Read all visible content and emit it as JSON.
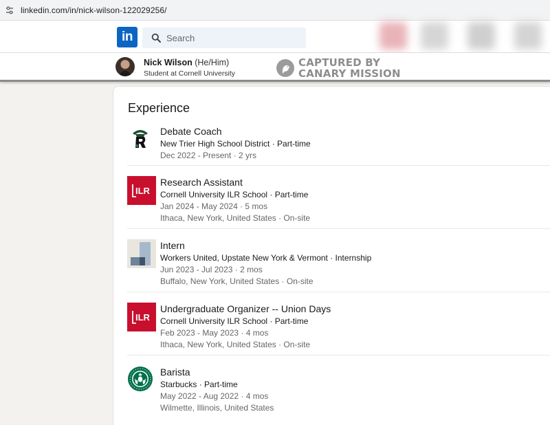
{
  "browser": {
    "url": "linkedin.com/in/nick-wilson-122029256/"
  },
  "nav": {
    "logo_text": "in",
    "search_placeholder": "Search"
  },
  "profile": {
    "name": "Nick Wilson",
    "pronouns": "(He/Him)",
    "headline": "Student at Cornell University"
  },
  "watermark": {
    "line1": "CAPTURED BY",
    "line2": "CANARY MISSION"
  },
  "experience": {
    "heading": "Experience",
    "items": [
      {
        "title": "Debate Coach",
        "company": "New Trier High School District · Part-time",
        "dates": "Dec 2022 - Present · 2 yrs",
        "location": "",
        "logo": "new-trier-trevian-logo"
      },
      {
        "title": "Research Assistant",
        "company": "Cornell University ILR School · Part-time",
        "dates": "Jan 2024 - May 2024 · 5 mos",
        "location": "Ithaca, New York, United States · On-site",
        "logo": "ilr-logo",
        "logo_text": "ILR"
      },
      {
        "title": "Intern",
        "company": "Workers United, Upstate New York & Vermont · Internship",
        "dates": "Jun 2023 - Jul 2023 · 2 mos",
        "location": "Buffalo, New York, United States · On-site",
        "logo": "company-placeholder-logo"
      },
      {
        "title": "Undergraduate Organizer -- Union Days",
        "company": "Cornell University ILR School · Part-time",
        "dates": "Feb 2023 - May 2023 · 4 mos",
        "location": "Ithaca, New York, United States · On-site",
        "logo": "ilr-logo",
        "logo_text": "ILR"
      },
      {
        "title": "Barista",
        "company": "Starbucks · Part-time",
        "dates": "May 2022 - Aug 2022 · 4 mos",
        "location": "Wilmette, Illinois, United States",
        "logo": "starbucks-logo"
      }
    ]
  },
  "colors": {
    "linkedin_blue": "#0a66c2",
    "ilr_red": "#c8102e",
    "starbucks_green": "#00704a",
    "new_trier_green": "#1d4d2f"
  }
}
